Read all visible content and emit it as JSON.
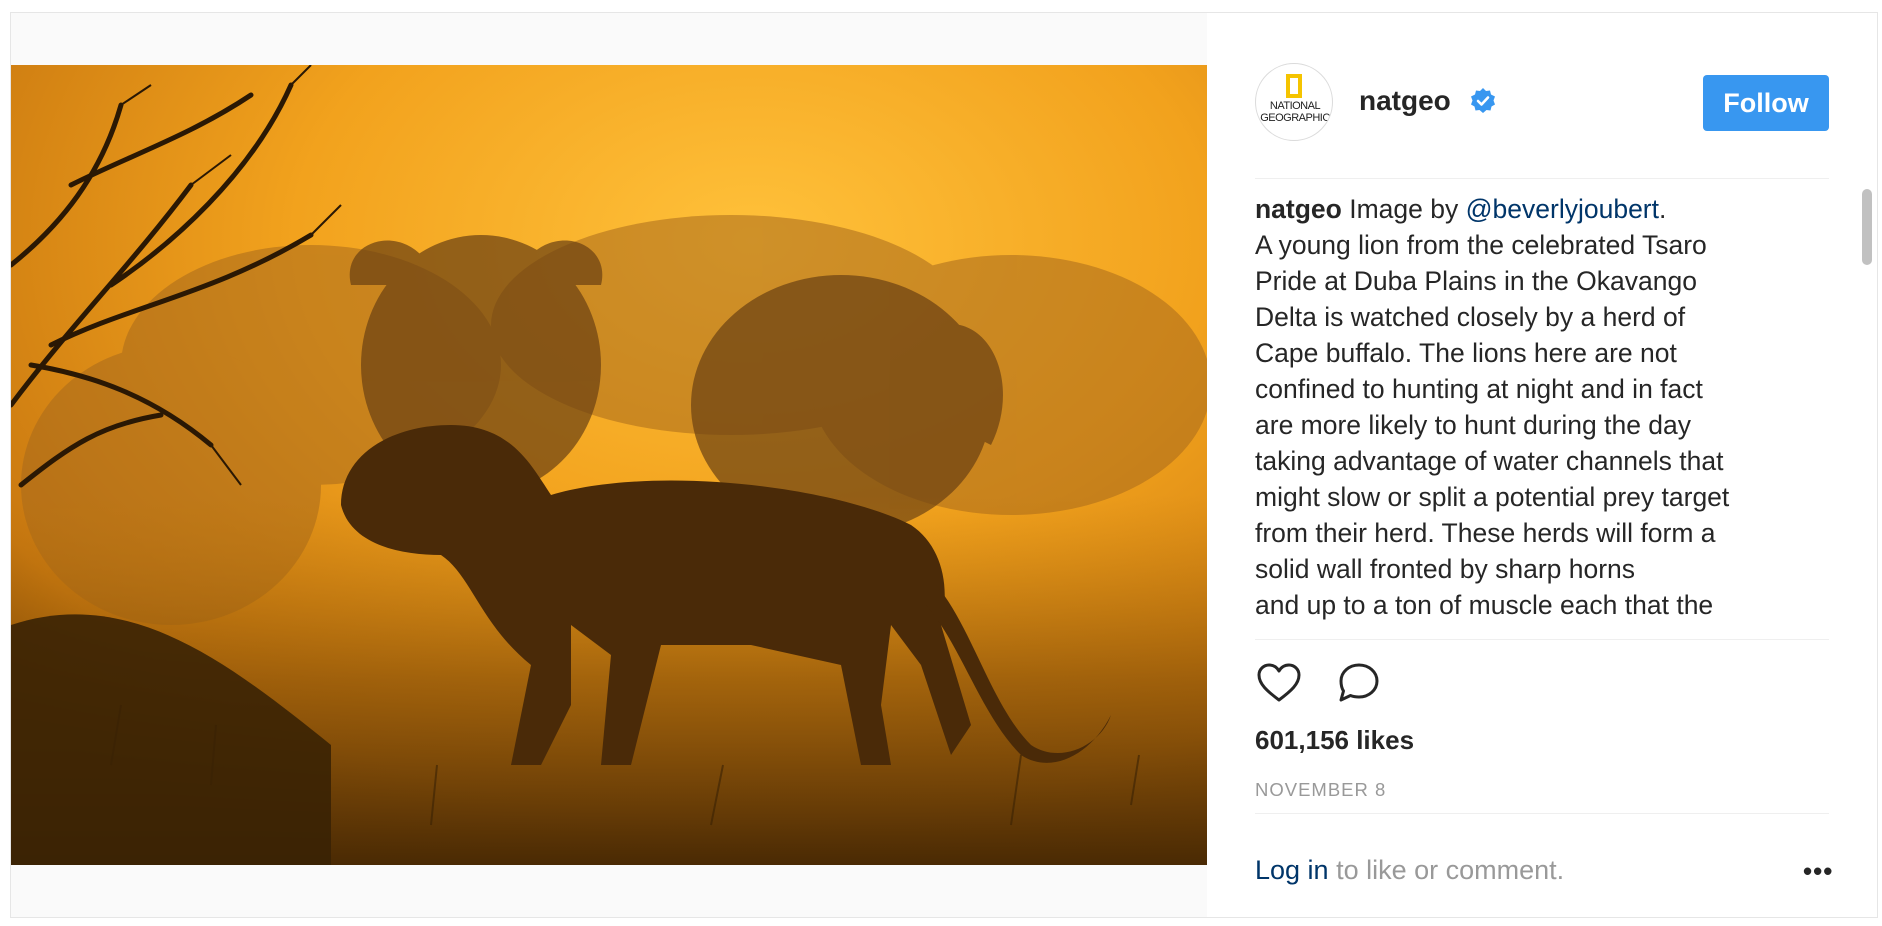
{
  "header": {
    "avatar_text": "NATIONAL GEOGRAPHIC",
    "username": "natgeo",
    "verified": true,
    "follow_label": "Follow"
  },
  "caption": {
    "username": "natgeo",
    "lead": "Image by",
    "mention": "@beverlyjoubert",
    "period": ".",
    "lines": [
      "A young lion from the celebrated Tsaro",
      "Pride at Duba Plains in the Okavango",
      "Delta is watched closely by a herd of",
      "Cape buffalo. The lions here are not",
      "confined to hunting at night and in fact",
      "are more likely to hunt during the day",
      "taking advantage of water channels that",
      "might slow or split a potential prey target",
      "from their herd. These herds will form a",
      "solid wall fronted by sharp horns",
      "and up to a ton of muscle each that the"
    ]
  },
  "actions": {
    "like_icon": "heart-icon",
    "comment_icon": "comment-icon"
  },
  "likes": "601,156 likes",
  "date": "NOVEMBER 8",
  "login": {
    "link": "Log in",
    "rest": " to like or comment."
  },
  "more_label": "•••",
  "colors": {
    "follow_bg": "#3897f0",
    "link": "#003569",
    "verified": "#3897f0",
    "muted": "#999999",
    "photo_glow": "#f0a020"
  }
}
